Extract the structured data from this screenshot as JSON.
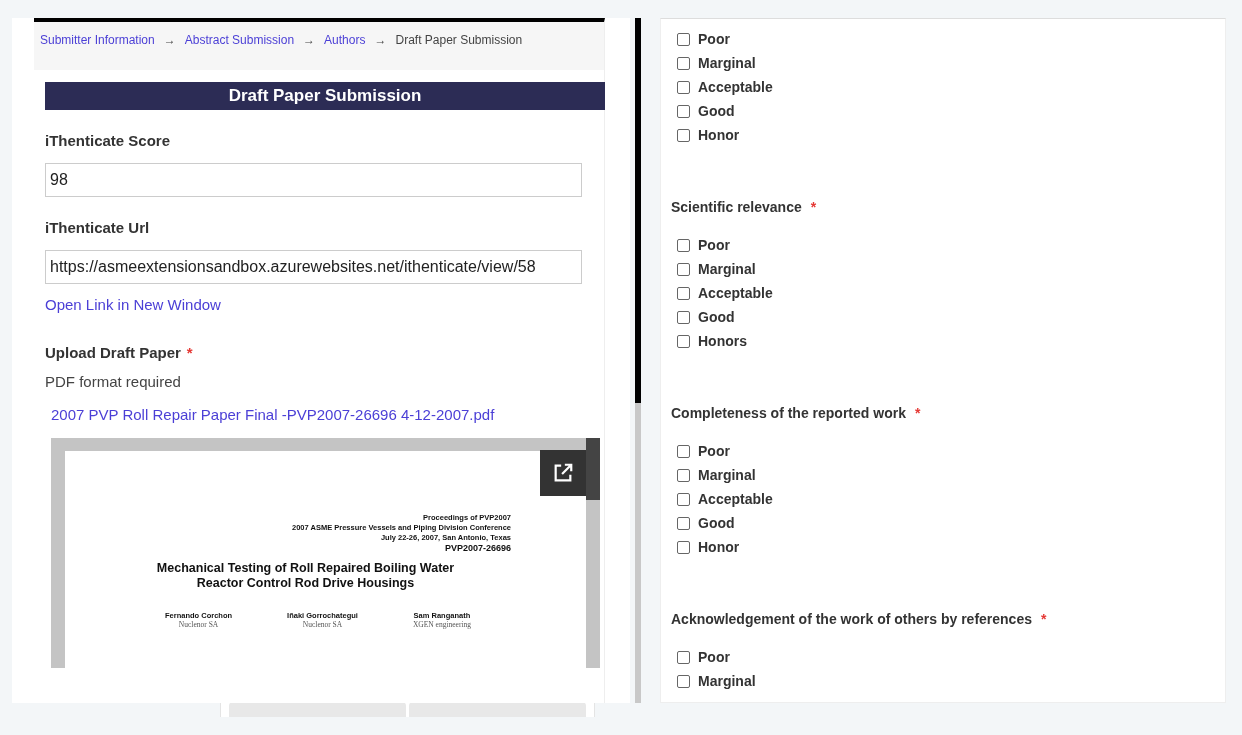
{
  "breadcrumb": [
    {
      "label": "Submitter Information",
      "link": true
    },
    {
      "label": "Abstract Submission",
      "link": true
    },
    {
      "label": "Authors",
      "link": true
    },
    {
      "label": "Draft Paper Submission",
      "link": false
    }
  ],
  "separator": "→",
  "section_title": "Draft Paper Submission",
  "fields": [
    {
      "label": "iThenticate Score",
      "value": "98"
    },
    {
      "label": "iThenticate Url",
      "value": "https://asmeextensionsandbox.azurewebsites.net/ithenticate/view/58"
    }
  ],
  "open_link": "Open Link in New Window",
  "upload": {
    "label": "Upload Draft Paper",
    "required_mark": "*",
    "hint": "PDF format required",
    "file_link": "2007 PVP Roll Repair Paper Final -PVP2007-26696 4-12-2007.pdf"
  },
  "preview": {
    "header_lines": [
      "Proceedings of PVP2007",
      "2007 ASME Pressure Vessels and Piping Division Conference",
      "July 22-26, 2007, San Antonio, Texas",
      "PVP2007-26696"
    ],
    "title_lines": [
      "Mechanical Testing of Roll Repaired Boiling Water",
      "Reactor Control Rod Drive Housings"
    ],
    "authors": [
      {
        "name": "Fernando Corchon",
        "affiliation": "Nuclenor SA"
      },
      {
        "name": "Iñaki Gorrochategui",
        "affiliation": "Nuclenor SA"
      },
      {
        "name": "Sam Ranganath",
        "affiliation": "XGEN engineering"
      }
    ]
  },
  "rating_groups": [
    {
      "options": [
        {
          "label": "Poor",
          "checked": false
        },
        {
          "label": "Marginal",
          "checked": false
        },
        {
          "label": "Acceptable",
          "checked": false
        },
        {
          "label": "Good",
          "checked": false
        },
        {
          "label": "Honor",
          "checked": false
        }
      ]
    },
    {
      "title": "Scientific relevance",
      "required_mark": "*",
      "options": [
        {
          "label": "Poor",
          "checked": false
        },
        {
          "label": "Marginal",
          "checked": false
        },
        {
          "label": "Acceptable",
          "checked": false
        },
        {
          "label": "Good",
          "checked": false
        },
        {
          "label": "Honors",
          "checked": false
        }
      ]
    },
    {
      "title": "Completeness of the reported work",
      "required_mark": "*",
      "options": [
        {
          "label": "Poor",
          "checked": false
        },
        {
          "label": "Marginal",
          "checked": false
        },
        {
          "label": "Acceptable",
          "checked": false
        },
        {
          "label": "Good",
          "checked": false
        },
        {
          "label": "Honor",
          "checked": false
        }
      ]
    },
    {
      "title": "Acknowledgement of the work of others by references",
      "required_mark": "*",
      "options": [
        {
          "label": "Poor",
          "checked": false
        },
        {
          "label": "Marginal",
          "checked": false
        }
      ]
    }
  ]
}
